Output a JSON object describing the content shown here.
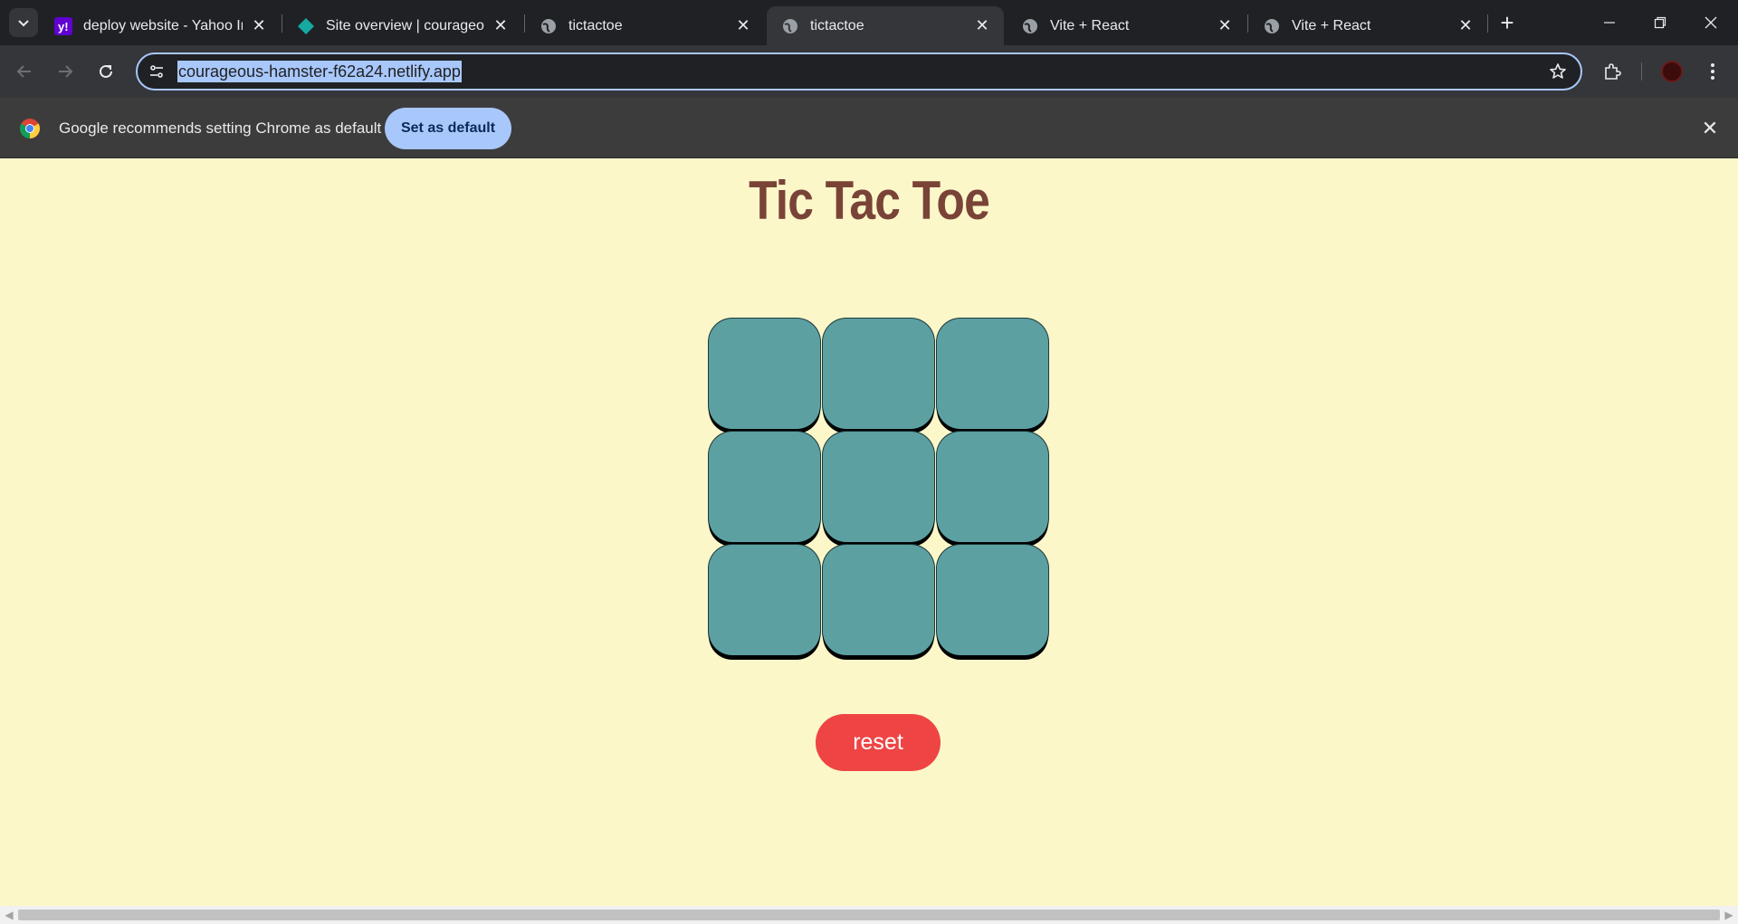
{
  "browser": {
    "tabs": [
      {
        "title": "deploy website - Yahoo Inc",
        "favicon": "yahoo-icon",
        "active": false
      },
      {
        "title": "Site overview | courageous",
        "favicon": "netlify-icon",
        "active": false
      },
      {
        "title": "tictactoe",
        "favicon": "globe-icon",
        "active": false
      },
      {
        "title": "tictactoe",
        "favicon": "globe-icon",
        "active": true
      },
      {
        "title": "Vite + React",
        "favicon": "globe-icon",
        "active": false
      },
      {
        "title": "Vite + React",
        "favicon": "globe-icon",
        "active": false
      }
    ],
    "address_bar": {
      "url": "courageous-hamster-f62a24.netlify.app"
    },
    "infobar": {
      "message": "Google recommends setting Chrome as default",
      "button_label": "Set as default"
    },
    "colors": {
      "chrome_bg": "#202124",
      "toolbar_bg": "#35363a",
      "accent": "#a8c7fa"
    }
  },
  "page": {
    "title": "Tic Tac Toe",
    "board": {
      "cells": [
        "",
        "",
        "",
        "",
        "",
        "",
        "",
        "",
        ""
      ]
    },
    "reset_label": "reset",
    "colors": {
      "background": "#fbf7c9",
      "title": "#7a4338",
      "cell": "#5ca0a2",
      "reset": "#ef4444"
    }
  }
}
